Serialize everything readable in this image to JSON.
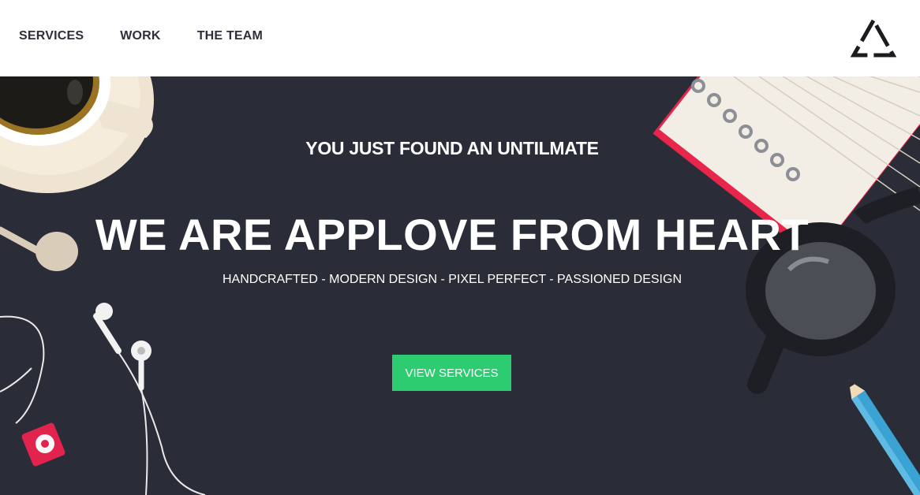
{
  "nav": {
    "items": [
      {
        "label": "SERVICES"
      },
      {
        "label": "WORK"
      },
      {
        "label": "THE TEAM"
      }
    ],
    "logo_icon": "triangle-logo-icon"
  },
  "hero": {
    "kicker": "YOU JUST FOUND AN UNTILMATE",
    "title": "WE ARE APPLOVE FROM HEART",
    "tagline": "HANDCRAFTED - MODERN DESIGN - PIXEL PERFECT - PASSIONED DESIGN",
    "cta_label": "VIEW SERVICES"
  },
  "colors": {
    "hero_background": "#2a2d38",
    "cta": "#2ecc71",
    "nav_text": "#2d303a"
  }
}
